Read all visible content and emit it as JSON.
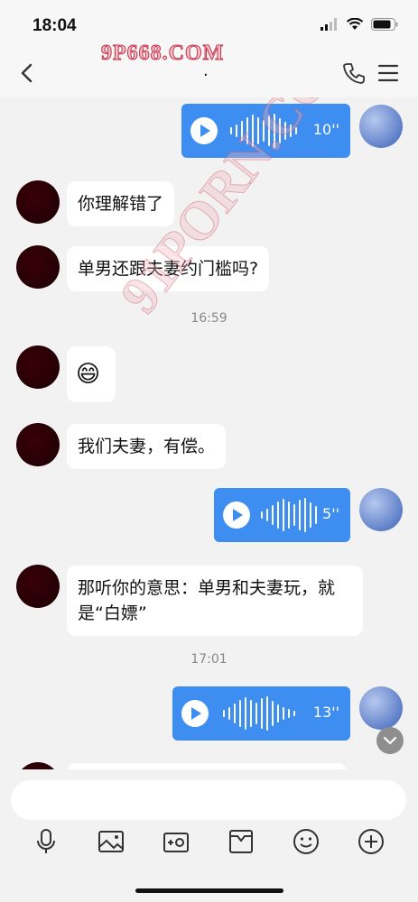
{
  "status": {
    "time": "18:04"
  },
  "nav": {
    "title": "."
  },
  "watermarks": {
    "top": "9P668.COM",
    "diagonal": "91PORN.COM"
  },
  "messages": {
    "voice1": {
      "duration": "10''"
    },
    "text1": "你理解错了",
    "text2": "单男还跟夫妻约门槛吗?",
    "time1": "16:59",
    "emoji1": "😄",
    "text3": "我们夫妻，有偿。",
    "voice2": {
      "duration": "5''"
    },
    "text4": "那听你的意思：单男和夫妻玩，就是“白嫖”",
    "time2": "17:01",
    "voice3": {
      "duration": "13''"
    }
  },
  "icons": {
    "back": "chevron-left-icon",
    "phone": "phone-icon",
    "menu": "menu-icon",
    "mic": "microphone-icon",
    "image": "image-icon",
    "camera": "camera-icon",
    "folder": "folder-icon",
    "emoji": "emoji-icon",
    "add": "plus-icon"
  },
  "colors": {
    "accent": "#3d8ef0",
    "bubble_left": "#ffffff",
    "background": "#f2f2f2"
  }
}
